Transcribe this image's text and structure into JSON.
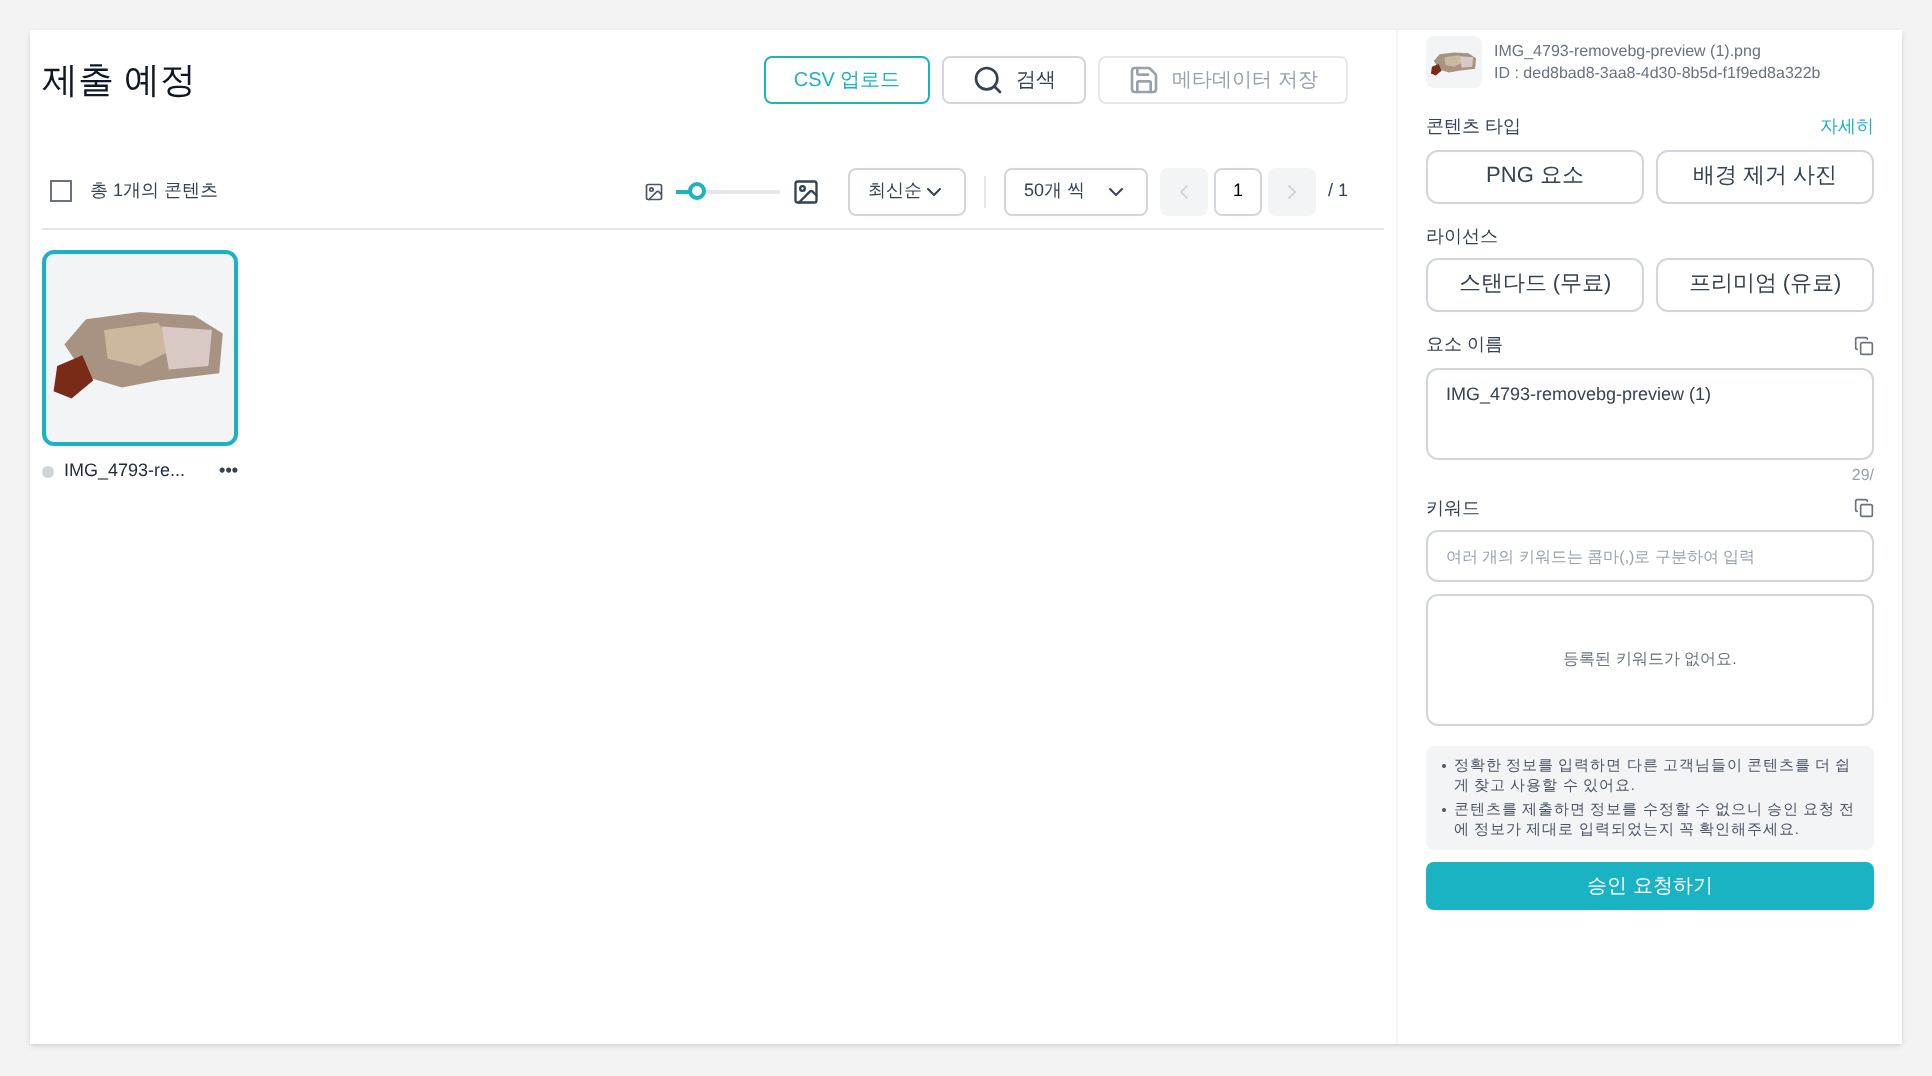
{
  "title": "제출 예정",
  "actions": [
    {
      "kind": "csv",
      "label": "CSV 업로드",
      "disabled": false
    },
    {
      "kind": "search",
      "label": "검색",
      "disabled": false
    },
    {
      "kind": "save",
      "label": "메타데이터 저장",
      "disabled": true
    }
  ],
  "toolbar": {
    "select_all": {
      "checked": false,
      "label": "총 1개의 콘텐츠"
    },
    "size_slider": {
      "level": 0.2
    },
    "sort": "최신순",
    "per_page": "50개 씩",
    "page": "1",
    "total_pages": "/ 1"
  },
  "items": [
    {
      "name": "IMG_4793-re...",
      "selected": true,
      "more": "•••"
    }
  ],
  "detail": {
    "file_name": "IMG_4793-removebg-preview (1).png",
    "id": "ID : ded8bad8-3aa8-4d30-8b5d-f1f9ed8a322b",
    "content_type": {
      "label": "콘텐츠 타입",
      "link": "자세히",
      "options": [
        {
          "label": "PNG 요소",
          "selected": false
        },
        {
          "label": "배경 제거 사진",
          "selected": false
        }
      ]
    },
    "license": {
      "label": "라이선스",
      "options": [
        {
          "label": "스탠다드 (무료)",
          "selected": false
        },
        {
          "label": "프리미엄 (유료)",
          "selected": false
        }
      ]
    },
    "element_name": {
      "label": "요소 이름",
      "value": "IMG_4793-removebg-preview (1)",
      "counter": "29/"
    },
    "keywords": {
      "label": "키워드",
      "placeholder": "여러 개의 키워드는 콤마(,)로 구분하여 입력",
      "empty": "등록된 키워드가 없어요."
    },
    "notes": [
      "정확한 정보를 입력하면 다른 고객님들이 콘텐츠를 더 쉽게 찾고 사용할 수 있어요.",
      "콘텐츠를 제출하면 정보를 수정할 수 없으니 승인 요청 전에 정보가 제대로 입력되었는지 꼭 확인해주세요."
    ],
    "submit": "승인 요청하기"
  }
}
